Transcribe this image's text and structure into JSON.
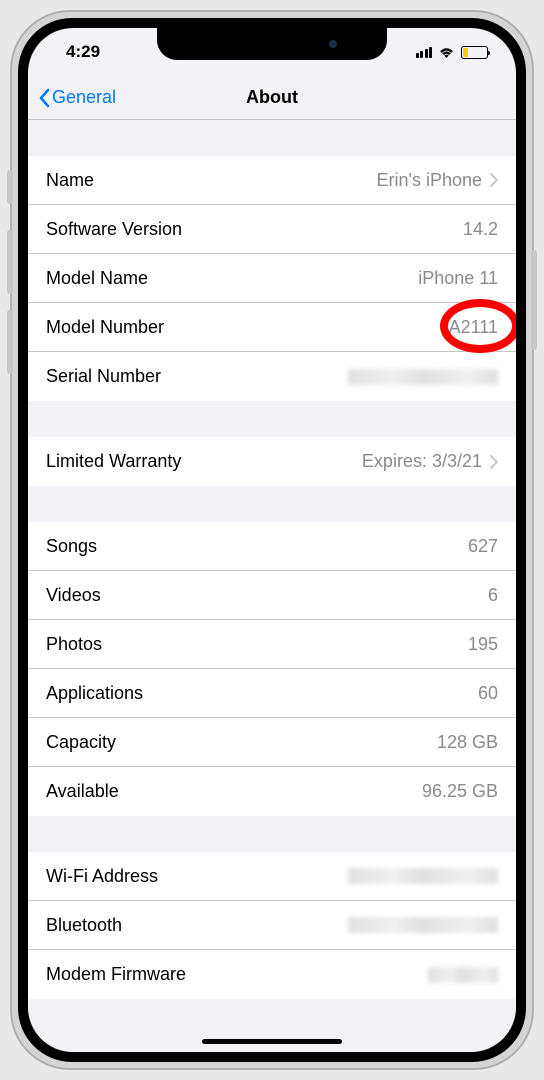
{
  "statusBar": {
    "time": "4:29"
  },
  "nav": {
    "back": "General",
    "title": "About"
  },
  "sections": [
    {
      "rows": [
        {
          "label": "Name",
          "value": "Erin's iPhone",
          "chevron": true
        },
        {
          "label": "Software Version",
          "value": "14.2"
        },
        {
          "label": "Model Name",
          "value": "iPhone 11"
        },
        {
          "label": "Model Number",
          "value": "A2111",
          "highlighted": true
        },
        {
          "label": "Serial Number",
          "blurred": true
        }
      ]
    },
    {
      "rows": [
        {
          "label": "Limited Warranty",
          "value": "Expires: 3/3/21",
          "chevron": true
        }
      ]
    },
    {
      "rows": [
        {
          "label": "Songs",
          "value": "627"
        },
        {
          "label": "Videos",
          "value": "6"
        },
        {
          "label": "Photos",
          "value": "195"
        },
        {
          "label": "Applications",
          "value": "60"
        },
        {
          "label": "Capacity",
          "value": "128 GB"
        },
        {
          "label": "Available",
          "value": "96.25 GB"
        }
      ]
    },
    {
      "rows": [
        {
          "label": "Wi-Fi Address",
          "blurred": true
        },
        {
          "label": "Bluetooth",
          "blurred": true
        },
        {
          "label": "Modem Firmware",
          "blurred": true,
          "small": true
        }
      ]
    }
  ]
}
